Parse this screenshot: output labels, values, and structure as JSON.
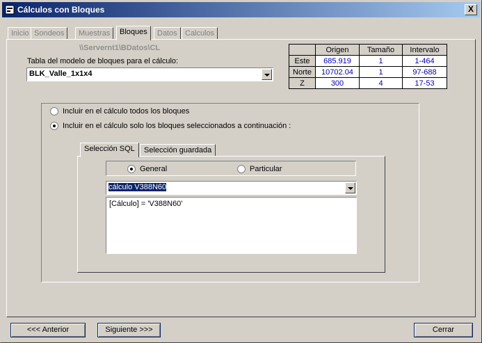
{
  "window": {
    "title": "Cálculos con Bloques",
    "close_label": "X"
  },
  "tabs": [
    {
      "label": "Inicio"
    },
    {
      "label": "Sondeos"
    },
    {
      "label": "Muestras"
    },
    {
      "label": "Bloques"
    },
    {
      "label": "Datos"
    },
    {
      "label": "Calculos"
    }
  ],
  "path": "\\\\Servernt1\\BDatos\\CL",
  "model": {
    "label": "Tabla del modelo de bloques para el cálculo:",
    "value": "BLK_Valle_1x1x4"
  },
  "grid": {
    "headers": [
      "Origen",
      "Tamaño",
      "Intervalo"
    ],
    "rows": [
      {
        "name": "Este",
        "origen": "685.919",
        "tamano": "1",
        "intervalo": "1-464"
      },
      {
        "name": "Norte",
        "origen": "10702.04",
        "tamano": "1",
        "intervalo": "97-688"
      },
      {
        "name": "Z",
        "origen": "300",
        "tamano": "4",
        "intervalo": "17-53"
      }
    ]
  },
  "options": {
    "all_blocks": "Incluir en el cálculo todos los bloques",
    "selected_blocks": "Incluir en el cálculo solo los bloques seleccionados a continuación :"
  },
  "subtabs": [
    {
      "label": "Selección SQL"
    },
    {
      "label": "Selección guardada"
    }
  ],
  "mode": {
    "general": "General",
    "particular": "Particular"
  },
  "query": {
    "selected": "cálculo V388N60",
    "text": "[Cálculo] = 'V388N60'"
  },
  "buttons": {
    "back": "<<<  Anterior",
    "next": "Siguiente  >>>",
    "close": "Cerrar"
  }
}
